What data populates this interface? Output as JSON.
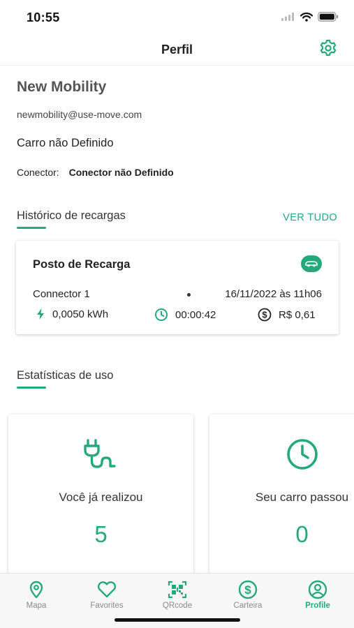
{
  "status_bar": {
    "time": "10:55"
  },
  "header": {
    "title": "Perfil",
    "settings_icon": "gear-icon"
  },
  "profile": {
    "name": "New Mobility",
    "email": "newmobility@use-move.com",
    "car": "Carro não Definido",
    "connector_label": "Conector:",
    "connector_value": "Conector não Definido"
  },
  "history": {
    "title": "Histórico de recargas",
    "see_all": "VER TUDO",
    "card": {
      "station": "Posto de Recarga",
      "connector": "Connector 1",
      "datetime": "16/11/2022 às 11h06",
      "energy": "0,0050 kWh",
      "duration": "00:00:42",
      "cost": "R$ 0,61"
    }
  },
  "stats": {
    "title": "Estatísticas de uso",
    "cards": [
      {
        "icon": "plug-icon",
        "label": "Você já realizou",
        "value": "5"
      },
      {
        "icon": "clock-icon",
        "label": "Seu carro passou",
        "value": "0"
      }
    ]
  },
  "tabs": [
    {
      "label": "Mapa",
      "icon": "map-pin-icon",
      "active": false
    },
    {
      "label": "Favorites",
      "icon": "heart-icon",
      "active": false
    },
    {
      "label": "QRcode",
      "icon": "qrcode-icon",
      "active": false
    },
    {
      "label": "Carteira",
      "icon": "dollar-icon",
      "active": false
    },
    {
      "label": "Profile",
      "icon": "profile-icon",
      "active": true
    }
  ],
  "colors": {
    "accent": "#23a97c",
    "inactive": "#8a8a8a"
  }
}
